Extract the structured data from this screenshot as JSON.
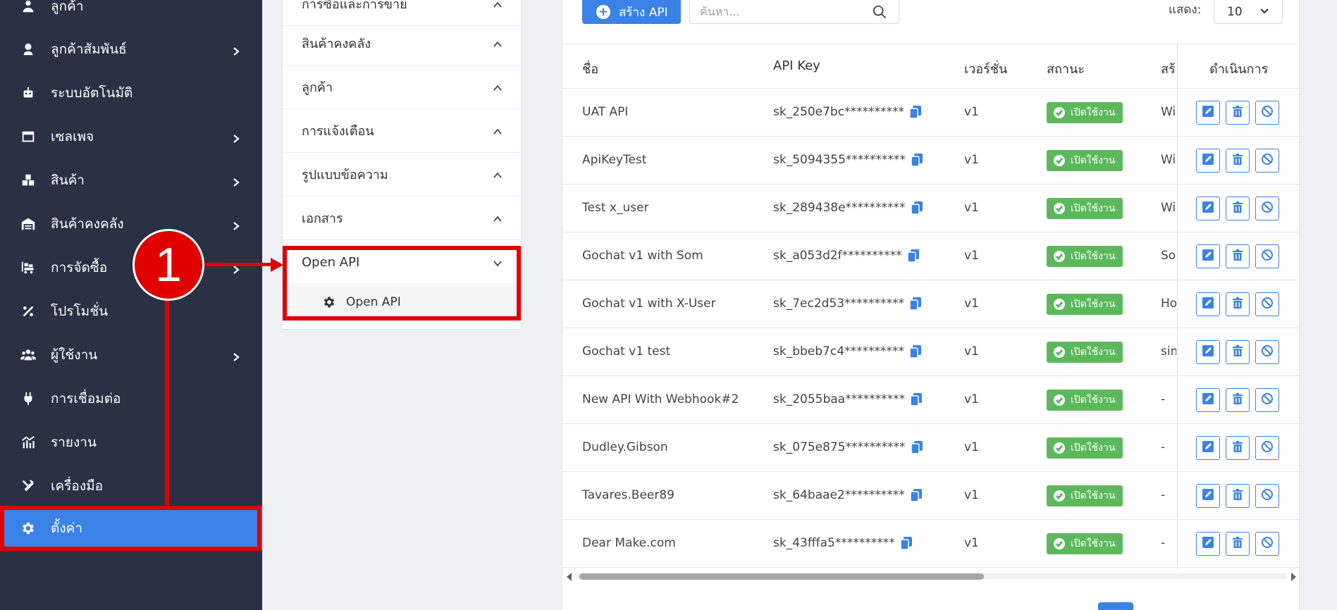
{
  "sidebar": {
    "items": [
      {
        "label": "ลูกค้า",
        "icon": "customers-icon",
        "chevron": false
      },
      {
        "label": "ลูกค้าสัมพันธ์",
        "icon": "crm-icon",
        "chevron": true
      },
      {
        "label": "ระบบอัตโนมัติ",
        "icon": "robot-icon",
        "chevron": false
      },
      {
        "label": "เซลเพจ",
        "icon": "webpage-icon",
        "chevron": true
      },
      {
        "label": "สินค้า",
        "icon": "boxes-icon",
        "chevron": true
      },
      {
        "label": "สินค้าคงคลัง",
        "icon": "warehouse-icon",
        "chevron": true
      },
      {
        "label": "การจัดซื้อ",
        "icon": "truck-icon",
        "chevron": true
      },
      {
        "label": "โปรโมชั่น",
        "icon": "percent-icon",
        "chevron": false
      },
      {
        "label": "ผู้ใช้งาน",
        "icon": "users-icon",
        "chevron": true
      },
      {
        "label": "การเชื่อมต่อ",
        "icon": "plug-icon",
        "chevron": false
      },
      {
        "label": "รายงาน",
        "icon": "chart-icon",
        "chevron": false
      },
      {
        "label": "เครื่องมือ",
        "icon": "tools-icon",
        "chevron": false
      },
      {
        "label": "ตั้งค่า",
        "icon": "gear-icon",
        "chevron": false,
        "active": true
      }
    ]
  },
  "settings_panel": {
    "groups": [
      {
        "label": "การซื้อและการขาย"
      },
      {
        "label": "สินค้าคงคลัง"
      },
      {
        "label": "ลูกค้า"
      },
      {
        "label": "การแจ้งเตือน"
      },
      {
        "label": "รูปแบบข้อความ"
      },
      {
        "label": "เอกสาร"
      },
      {
        "label": "Open API"
      }
    ],
    "subitem": {
      "label": "Open API",
      "icon": "gear-icon"
    }
  },
  "toolbar": {
    "create_label": "สร้าง API",
    "search_placeholder": "ค้นหา...",
    "show_label": "แสดง:",
    "page_size": "10"
  },
  "table": {
    "headers": {
      "name": "ชื่อ",
      "api_key": "API Key",
      "version": "เวอร์ชั่น",
      "status": "สถานะ",
      "created": "สร้",
      "actions": "ดำเนินการ"
    },
    "rows": [
      {
        "name": "UAT API",
        "key": "sk_250e7bc**********",
        "version": "v1",
        "status": "เปิดใช้งาน",
        "created": "Wi"
      },
      {
        "name": "ApiKeyTest",
        "key": "sk_5094355**********",
        "version": "v1",
        "status": "เปิดใช้งาน",
        "created": "Wi"
      },
      {
        "name": "Test x_user",
        "key": "sk_289438e**********",
        "version": "v1",
        "status": "เปิดใช้งาน",
        "created": "Wi"
      },
      {
        "name": "Gochat v1 with Som",
        "key": "sk_a053d2f**********",
        "version": "v1",
        "status": "เปิดใช้งาน",
        "created": "So"
      },
      {
        "name": "Gochat v1 with X-User",
        "key": "sk_7ec2d53**********",
        "version": "v1",
        "status": "เปิดใช้งาน",
        "created": "Ho"
      },
      {
        "name": "Gochat v1 test",
        "key": "sk_bbeb7c4**********",
        "version": "v1",
        "status": "เปิดใช้งาน",
        "created": "sim"
      },
      {
        "name": "New API With Webhook#2",
        "key": "sk_2055baa**********",
        "version": "v1",
        "status": "เปิดใช้งาน",
        "created": "-"
      },
      {
        "name": "Dudley.Gibson",
        "key": "sk_075e875**********",
        "version": "v1",
        "status": "เปิดใช้งาน",
        "created": "-"
      },
      {
        "name": "Tavares.Beer89",
        "key": "sk_64baae2**********",
        "version": "v1",
        "status": "เปิดใช้งาน",
        "created": "-"
      },
      {
        "name": "Dear Make.com",
        "key": "sk_43fffa5**********",
        "version": "v1",
        "status": "เปิดใช้งาน",
        "created": "-"
      }
    ]
  },
  "annotation": {
    "marker_number": "1"
  },
  "colors": {
    "primary": "#3b82e6",
    "sidebar_bg": "#2b3144",
    "success": "#5cb85c",
    "annotation": "#e10000"
  }
}
